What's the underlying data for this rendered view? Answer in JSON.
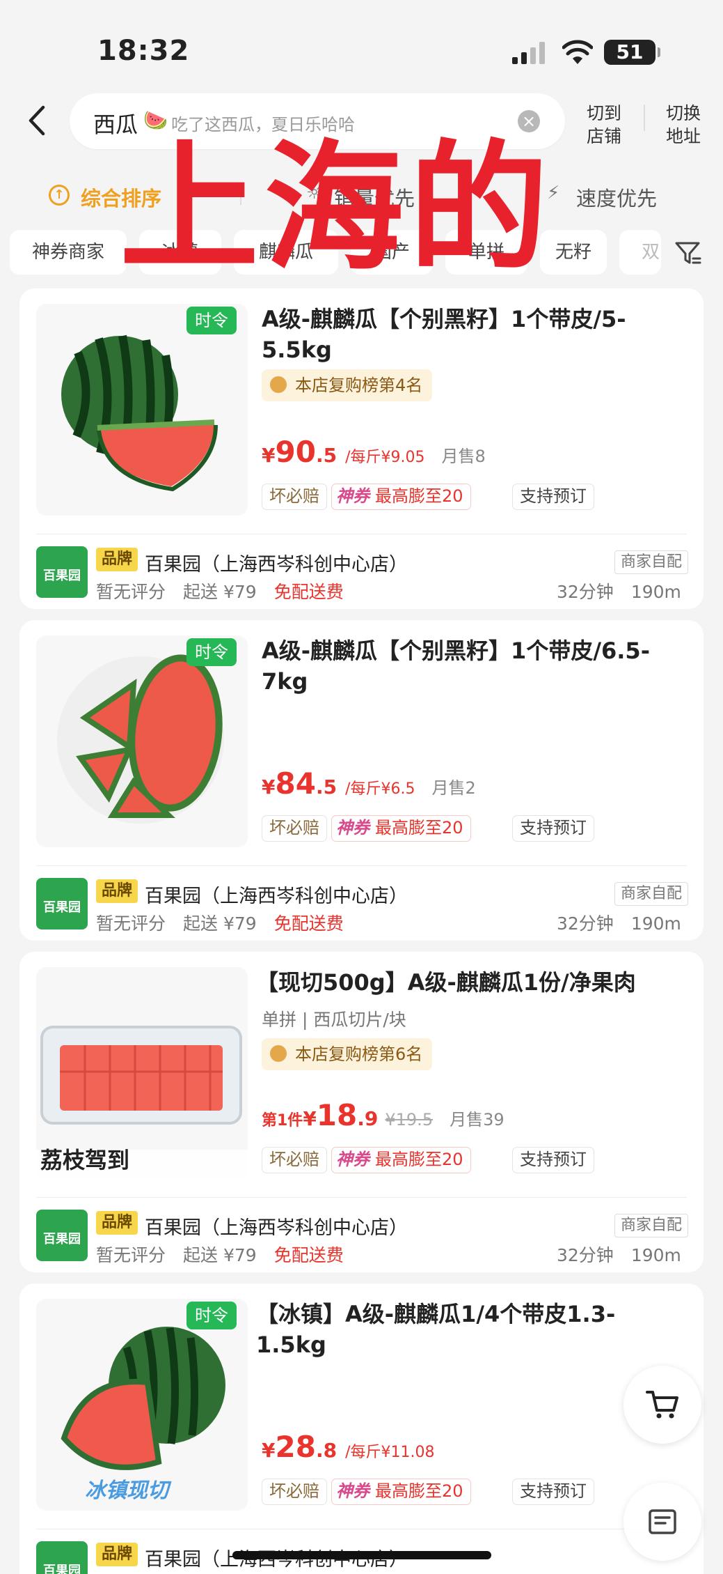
{
  "status": {
    "time": "18:32",
    "battery": "51"
  },
  "search": {
    "keyword": "西瓜",
    "emoji": "🍉",
    "hint": "吃了这西瓜，夏日乐哈哈",
    "to_store_label": "切到\n店铺",
    "switch_addr_label": "切换\n地址"
  },
  "sort": {
    "items": [
      "综合排序",
      "销量优先",
      "速度优先"
    ]
  },
  "chips": [
    "神券商家",
    "冰镇",
    "麒麟瓜",
    "国产",
    "单拼",
    "无籽",
    "双"
  ],
  "overlay_text": "上海的",
  "products": [
    {
      "badge": "时令",
      "title": "A级-麒麟瓜【个别黑籽】1个带皮/5-5.5kg",
      "rank": "本店复购榜第4名",
      "price_int": "90",
      "price_dec": ".5",
      "unit_price": "/每斤¥9.05",
      "sold": "月售8",
      "tags": [
        "坏必赔",
        "神券",
        "最高膨至20",
        "支持预订"
      ],
      "brand": "品牌",
      "store": "百果园（上海西岑科创中心店）",
      "rating": "暂无评分",
      "min": "起送 ¥79",
      "free": "免配送费",
      "delivery_type": "商家自配",
      "eta": "32分钟",
      "distance": "190m"
    },
    {
      "badge": "时令",
      "title": "A级-麒麟瓜【个别黑籽】1个带皮/6.5-7kg",
      "price_int": "84",
      "price_dec": ".5",
      "unit_price": "/每斤¥6.5",
      "sold": "月售2",
      "tags": [
        "坏必赔",
        "神券",
        "最高膨至20",
        "支持预订"
      ],
      "brand": "品牌",
      "store": "百果园（上海西岑科创中心店）",
      "rating": "暂无评分",
      "min": "起送 ¥79",
      "free": "免配送费",
      "delivery_type": "商家自配",
      "eta": "32分钟",
      "distance": "190m"
    },
    {
      "title": "【现切500g】A级-麒麟瓜1份/净果肉",
      "sub": "单拼 | 西瓜切片/块",
      "rank": "本店复购榜第6名",
      "promo": "荔枝驾到",
      "first_label": "第1件",
      "price_int": "18",
      "price_dec": ".9",
      "orig_price": "¥19.5",
      "sold": "月售39",
      "tags": [
        "坏必赔",
        "神券",
        "最高膨至20",
        "支持预订"
      ],
      "brand": "品牌",
      "store": "百果园（上海西岑科创中心店）",
      "rating": "暂无评分",
      "min": "起送 ¥79",
      "free": "免配送费",
      "delivery_type": "商家自配",
      "eta": "32分钟",
      "distance": "190m"
    },
    {
      "badge": "时令",
      "title": "【冰镇】A级-麒麟瓜1/4个带皮1.3-1.5kg",
      "promo": "冰镇现切",
      "price_int": "28",
      "price_dec": ".8",
      "unit_price": "/每斤¥11.08",
      "tags": [
        "坏必赔",
        "神券",
        "最高膨至20",
        "支持预订"
      ],
      "brand": "品牌",
      "store": "百果园（上海西岑科创中心店）"
    }
  ],
  "logo_text": "百果园",
  "colors": {
    "accent": "#f0a020",
    "price": "#e8342c",
    "green": "#26b757",
    "overlay": "#e8222c"
  }
}
